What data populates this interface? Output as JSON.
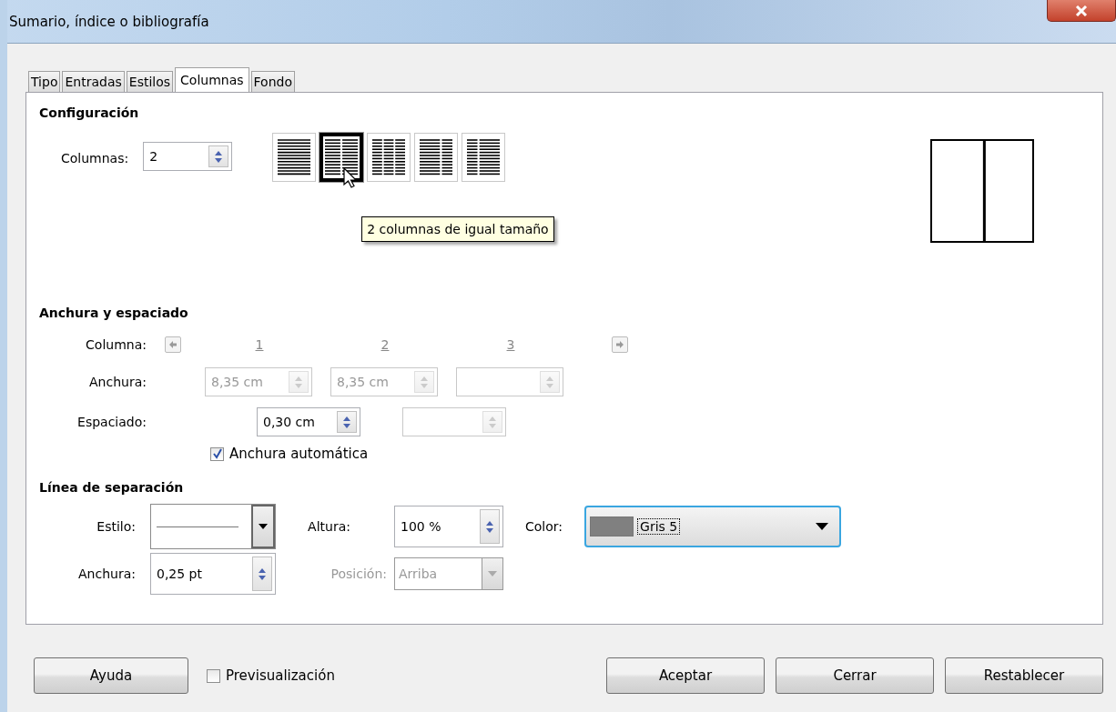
{
  "window": {
    "title": "Sumario, índice o bibliografía"
  },
  "tabs": [
    {
      "label": "Tipo",
      "selected": false
    },
    {
      "label": "Entradas",
      "selected": false
    },
    {
      "label": "Estilos",
      "selected": false
    },
    {
      "label": "Columnas",
      "selected": true
    },
    {
      "label": "Fondo",
      "selected": false
    }
  ],
  "configuration": {
    "heading": "Configuración",
    "columns_label": "Columnas:",
    "columns_value": "2",
    "presets": [
      {
        "kind": "one",
        "selected": false
      },
      {
        "kind": "two",
        "selected": true
      },
      {
        "kind": "three",
        "selected": false
      },
      {
        "kind": "left",
        "selected": false
      },
      {
        "kind": "right",
        "selected": false
      }
    ],
    "tooltip": "2 columnas de igual tamaño"
  },
  "width_spacing": {
    "heading": "Anchura y espaciado",
    "column_label": "Columna:",
    "prev_disabled": true,
    "next_disabled": true,
    "column_numbers": [
      "1",
      "2",
      "3"
    ],
    "width_label": "Anchura:",
    "widths": [
      {
        "value": "8,35 cm",
        "disabled": true
      },
      {
        "value": "8,35 cm",
        "disabled": true
      },
      {
        "disabled": true
      }
    ],
    "spacing_label": "Espaciado:",
    "spacings": [
      {
        "value": "0,30 cm",
        "disabled": false
      },
      {
        "disabled": true
      }
    ],
    "auto_width": {
      "label": "Anchura automática",
      "checked": true
    }
  },
  "separator": {
    "heading": "Línea de separación",
    "style_label": "Estilo:",
    "height_label": "Altura:",
    "height_value": "100 %",
    "color_label": "Color:",
    "color": {
      "name": "Gris 5",
      "color": "#808080"
    },
    "width_label": "Anchura:",
    "width_value": "0,25 pt",
    "position_label": "Posición:",
    "position_value": "Arriba",
    "position_disabled": true
  },
  "footer": {
    "help": "Ayuda",
    "preview": {
      "label": "Previsualización",
      "checked": false
    },
    "buttons": [
      "Aceptar",
      "Cerrar",
      "Restablecer"
    ]
  }
}
